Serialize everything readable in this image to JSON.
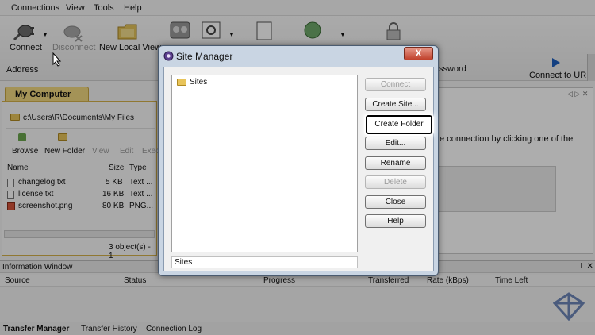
{
  "menu": [
    "Connections",
    "View",
    "Tools",
    "Help"
  ],
  "ribbon": {
    "connect": "Connect",
    "disconnect": "Disconnect",
    "new_local_view": "New Local View",
    "address": "Address",
    "password_fragment": "ssword",
    "connect_to_url": "Connect to URL"
  },
  "left_pane": {
    "tab": "My Computer",
    "path": "c:\\Users\\R\\Documents\\My Files",
    "toolbar": [
      "Browse",
      "New Folder",
      "View",
      "Edit",
      "Exec"
    ],
    "columns": [
      "Name",
      "Size",
      "Type"
    ],
    "files": [
      {
        "name": "changelog.txt",
        "size": "5 KB",
        "type": "Text ..."
      },
      {
        "name": "license.txt",
        "size": "16 KB",
        "type": "Text ..."
      },
      {
        "name": "screenshot.png",
        "size": "80 KB",
        "type": "PNG..."
      }
    ],
    "status": "3 object(s) - 1"
  },
  "right_pane": {
    "hint": "te connection by clicking one of the"
  },
  "info_window": {
    "title": "Information Window",
    "columns": [
      "Source",
      "Status",
      "Progress",
      "Transferred",
      "Rate (kBps)",
      "Time Left"
    ]
  },
  "bottom_tabs": [
    "Transfer Manager",
    "Transfer History",
    "Connection Log"
  ],
  "dialog": {
    "title": "Site Manager",
    "close_glyph": "X",
    "tree_root": "Sites",
    "status": "Sites",
    "buttons": {
      "connect": "Connect",
      "create_site": "Create Site...",
      "create_folder": "Create Folder",
      "edit": "Edit...",
      "rename": "Rename",
      "delete": "Delete",
      "close": "Close",
      "help": "Help"
    }
  }
}
